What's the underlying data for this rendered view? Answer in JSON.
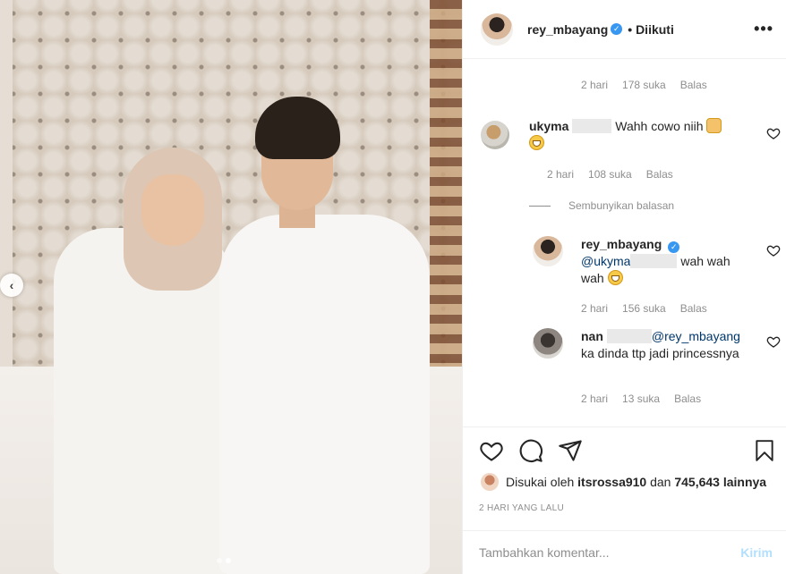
{
  "post": {
    "author": "rey_mbayang",
    "follow_status": "• Diikuti",
    "more_icon": "more-options-icon"
  },
  "top_meta": {
    "time": "2 hari",
    "likes": "178 suka",
    "reply": "Balas"
  },
  "comments": [
    {
      "user": "ukyma",
      "text": "Wahh cowo niih",
      "emoji_after_text": "raising-hands-emoji",
      "emoji_line2": "grinning-emoji",
      "time": "2 hari",
      "likes": "108 suka",
      "reply": "Balas"
    }
  ],
  "hide_replies_label": "Sembunyikan balasan",
  "replies": [
    {
      "user": "rey_mbayang",
      "verified": true,
      "mention": "@ukyma",
      "text": "wah wah wah",
      "emoji": "grinning-squint-emoji",
      "time": "2 hari",
      "likes": "156 suka",
      "reply": "Balas"
    },
    {
      "user": "nan",
      "mention": "@rey_mbayang",
      "text": "ka dinda ttp jadi princessnya",
      "time": "2 hari",
      "likes": "13 suka",
      "reply": "Balas"
    }
  ],
  "likes_summary": {
    "prefix": "Disukai oleh",
    "user": "itsrossa910",
    "middle": "dan",
    "count": "745,643 lainnya"
  },
  "post_date": "2 HARI YANG LALU",
  "add_comment": {
    "placeholder": "Tambahkan komentar...",
    "post_label": "Kirim"
  },
  "carousel": {
    "total": 2,
    "active": 2
  },
  "colors": {
    "link": "#00376b",
    "verified": "#3897f0",
    "post_disabled": "#b2dffc",
    "muted": "#8e8e8e"
  }
}
